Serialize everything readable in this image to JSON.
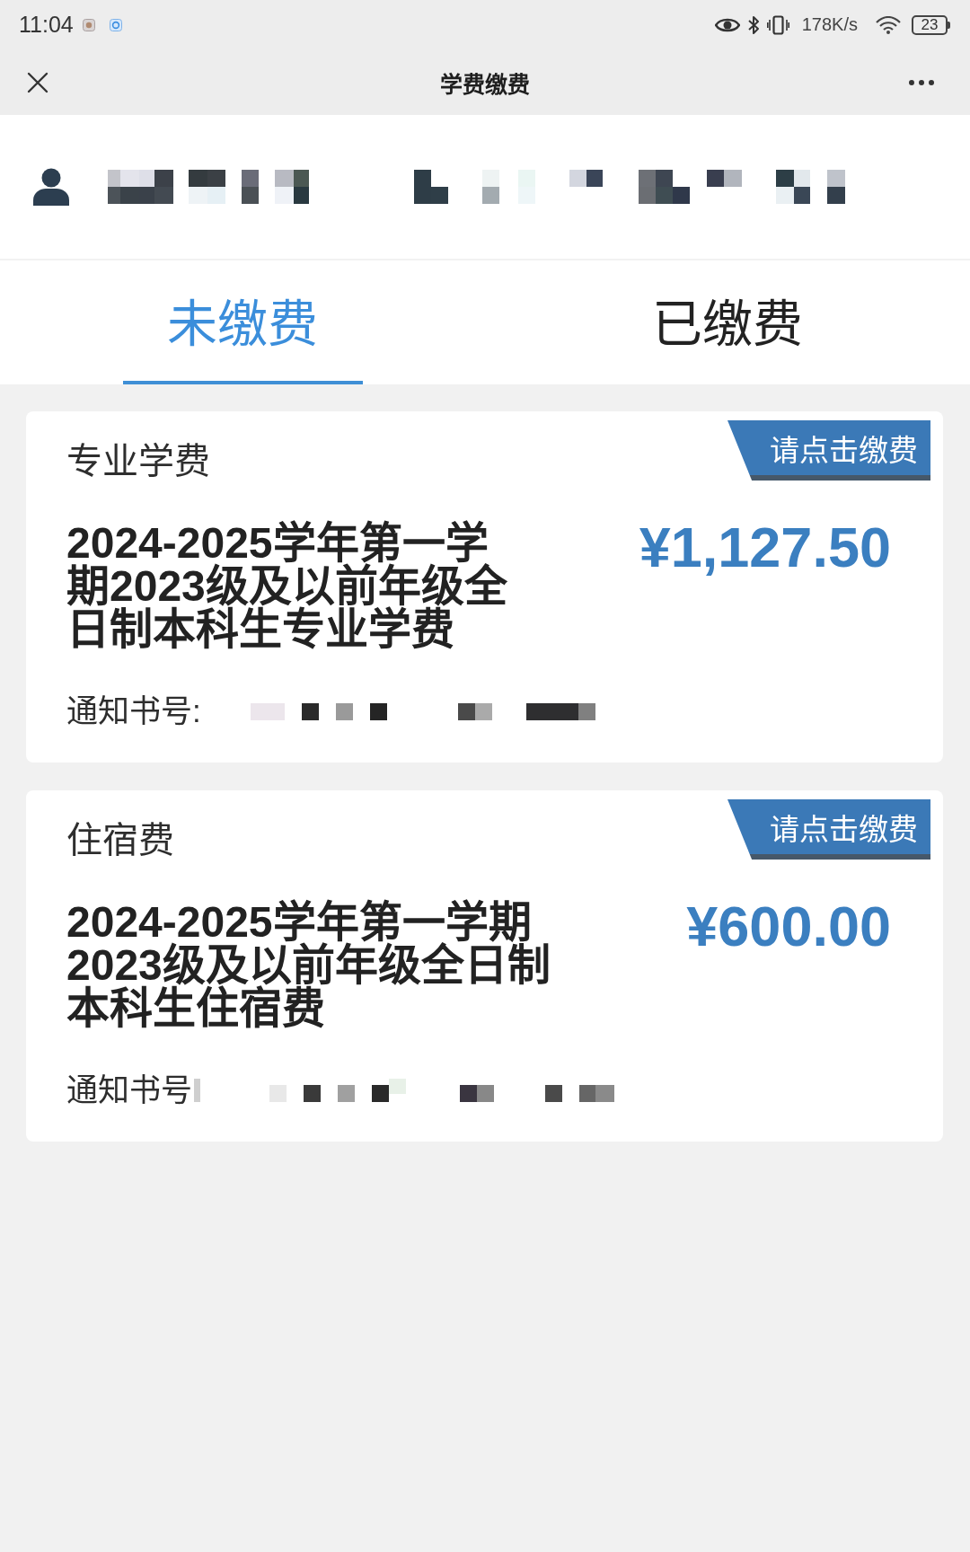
{
  "status_bar": {
    "time": "11:04",
    "network_speed": "178K/s",
    "battery": "23"
  },
  "title_bar": {
    "title": "学费缴费"
  },
  "tabs": [
    {
      "label": "未缴费",
      "selected": true
    },
    {
      "label": "已缴费",
      "selected": false
    }
  ],
  "bills": [
    {
      "category": "专业学费",
      "pay_button": "请点击缴费",
      "description": "2024-2025学年第一学期2023级及以前年级全日制本科生专业学费",
      "amount": "¥1,127.50",
      "notice_label": "通知书号:"
    },
    {
      "category": "住宿费",
      "pay_button": "请点击缴费",
      "description": "2024-2025学年第一学期2023级及以前年级全日制本科生住宿费",
      "amount": "¥600.00",
      "notice_label": "通知书号"
    }
  ]
}
